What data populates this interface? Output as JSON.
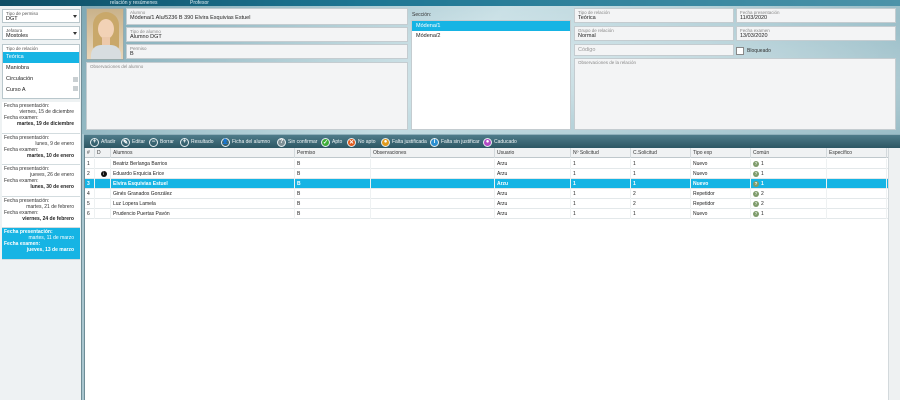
{
  "topbar": {
    "tabs": [
      "relación y resúmenes",
      "Profesor"
    ]
  },
  "sidebar": {
    "permit_type": {
      "label": "Tipo de permiso",
      "value": "DGT"
    },
    "school": {
      "label": "Jefatura",
      "value": "Mostoles"
    },
    "relation_type": {
      "label": "Tipo de relación",
      "items": [
        "Teórica",
        "Maniobra",
        "Circulación",
        "Curso A"
      ],
      "selected": 0
    },
    "dates": [
      {
        "presentation_label": "Fecha presentación:",
        "presentation": "viernes, 15 de diciembre",
        "exam_label": "Fecha examen:",
        "exam": "martes, 19 de diciembre"
      },
      {
        "presentation_label": "Fecha presentación:",
        "presentation": "lunes, 9 de enero",
        "exam_label": "Fecha examen:",
        "exam": "martes, 10 de enero"
      },
      {
        "presentation_label": "Fecha presentación:",
        "presentation": "jueves, 26 de enero",
        "exam_label": "Fecha examen:",
        "exam": "lunes, 30 de enero"
      },
      {
        "presentation_label": "Fecha presentación:",
        "presentation": "martes, 21 de febrero",
        "exam_label": "Fecha examen:",
        "exam": "viernes, 24 de febrero"
      },
      {
        "presentation_label": "Fecha presentación:",
        "presentation": "martes, 11 de marzo",
        "exam_label": "Fecha examen:",
        "exam": "jueves, 13 de marzo"
      }
    ],
    "selected_date": 4
  },
  "form": {
    "student": {
      "label": "Alumno",
      "value": "Módena/1 Alu/5236 B 390 Elvira Esquivias Estuel"
    },
    "student_type": {
      "label": "Tipo de alumno",
      "value": "Alumno DGT"
    },
    "permit": {
      "label": "Permiso",
      "value": "B"
    },
    "student_notes": {
      "label": "Observaciones del alumno",
      "value": ""
    },
    "section_label": "Sección:",
    "sections": [
      "Módena/1",
      "Módena/2"
    ],
    "section_selected": 0,
    "relation_type": {
      "label": "Tipo de relación",
      "value": "Teórica"
    },
    "relation_group": {
      "label": "Grupo de relación",
      "value": "Normal"
    },
    "code": {
      "label": "",
      "value": "Código"
    },
    "relation_notes": {
      "label": "Observaciones de la relación",
      "value": ""
    },
    "presentation_date": {
      "label": "Fecha presentación",
      "value": "11/03/2020"
    },
    "exam_date": {
      "label": "Fecha examen",
      "value": "13/03/2020"
    },
    "blocked_label": "Bloqueado"
  },
  "toolbar": {
    "buttons": [
      {
        "label": "Añadir",
        "icon": "+",
        "color": "#3c6a78"
      },
      {
        "label": "Editar",
        "icon": "✎",
        "color": "#3c6a78"
      },
      {
        "label": "Borrar",
        "icon": "−",
        "color": "#3c6a78"
      },
      {
        "label": "Resultado",
        "icon": "+",
        "color": "#3c6a78"
      },
      {
        "label": "Ficha del alumno",
        "icon": "👤",
        "color": "#3c6a78"
      },
      {
        "label": "Sin confirmar",
        "icon": "?",
        "color": "#7d8f95"
      },
      {
        "label": "Apto",
        "icon": "✓",
        "color": "#3fae3a"
      },
      {
        "label": "No apto",
        "icon": "✕",
        "color": "#e05a1c"
      },
      {
        "label": "Falta justificada",
        "icon": "●",
        "color": "#e09a1c"
      },
      {
        "label": "Falta sin justificar",
        "icon": "i",
        "color": "#2a8fd0"
      },
      {
        "label": "Caducado",
        "icon": "●",
        "color": "#b34bc4"
      }
    ]
  },
  "grid": {
    "headers": [
      "#",
      "D",
      "Alumnos",
      "Permiso",
      "Observaciones",
      "Usuario",
      "Nº Solicitud",
      "C.Solicitud",
      "Tipo exp",
      "Común",
      "Específico"
    ],
    "rows": [
      {
        "n": "1",
        "d": "",
        "name": "Beatriz Berlanga Barrios",
        "permit": "B",
        "notes": "",
        "user": "Arzu",
        "req": "1",
        "creq": "1",
        "type": "Nuevo",
        "common": "1",
        "specific": ""
      },
      {
        "n": "2",
        "d": "i",
        "name": "Eduardo Erquicia Erice",
        "permit": "B",
        "notes": "",
        "user": "Arzu",
        "req": "1",
        "creq": "1",
        "type": "Nuevo",
        "common": "1",
        "specific": ""
      },
      {
        "n": "3",
        "d": "",
        "name": "Elvira Esquivias Estuel",
        "permit": "B",
        "notes": "",
        "user": "Arzu",
        "req": "1",
        "creq": "1",
        "type": "Nuevo",
        "common": "1",
        "specific": ""
      },
      {
        "n": "4",
        "d": "",
        "name": "Ginés Granados González",
        "permit": "B",
        "notes": "",
        "user": "Arzu",
        "req": "1",
        "creq": "2",
        "type": "Repetidor",
        "common": "2",
        "specific": ""
      },
      {
        "n": "5",
        "d": "",
        "name": "Luz Lopera Lamela",
        "permit": "B",
        "notes": "",
        "user": "Arzu",
        "req": "1",
        "creq": "2",
        "type": "Repetidor",
        "common": "2",
        "specific": ""
      },
      {
        "n": "6",
        "d": "",
        "name": "Prudencio Puertas Pavón",
        "permit": "B",
        "notes": "",
        "user": "Arzu",
        "req": "1",
        "creq": "1",
        "type": "Nuevo",
        "common": "1",
        "specific": ""
      }
    ],
    "selected_row": 2
  }
}
